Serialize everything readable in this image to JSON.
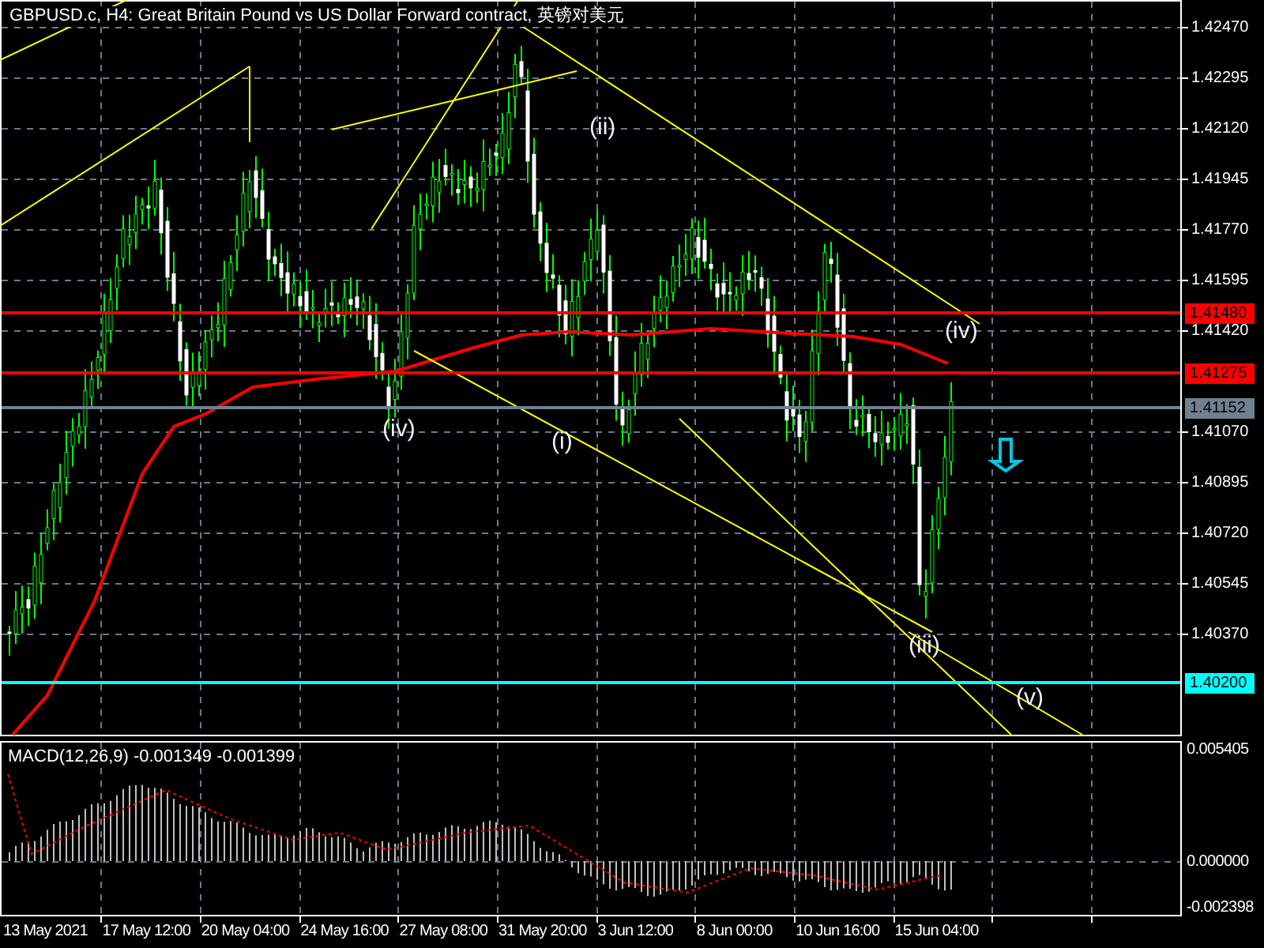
{
  "chart": {
    "title": "GBPUSD.c, H4:  Great Britain Pound vs US Dollar Forward contract, 英镑对美元",
    "price_axis": [
      "1.42470",
      "1.42295",
      "1.42120",
      "1.41945",
      "1.41770",
      "1.41595",
      "1.41420",
      "1.41070",
      "1.40895",
      "1.40720",
      "1.40545",
      "1.40370"
    ],
    "levels": [
      {
        "label": "1.41480",
        "color": "#ff0000"
      },
      {
        "label": "1.41275",
        "color": "#ff0000"
      },
      {
        "label": "1.41152",
        "color": "#708090"
      },
      {
        "label": "1.40200",
        "color": "#00ffff"
      }
    ],
    "wave_labels": [
      "(ii)",
      "(iv)",
      "(i)",
      "(iii)",
      "(iv)",
      "(v)"
    ]
  },
  "macd": {
    "title": "MACD(12,26,9) -0.001349 -0.001399",
    "axis": [
      "0.005405",
      "0.000000",
      "-0.002398"
    ]
  },
  "time_axis": [
    "13 May 2021",
    "17 May 12:00",
    "20 May 04:00",
    "24 May 16:00",
    "27 May 08:00",
    "31 May 20:00",
    "3 Jun 12:00",
    "8 Jun 00:00",
    "10 Jun 16:00",
    "15 Jun 04:00"
  ]
}
